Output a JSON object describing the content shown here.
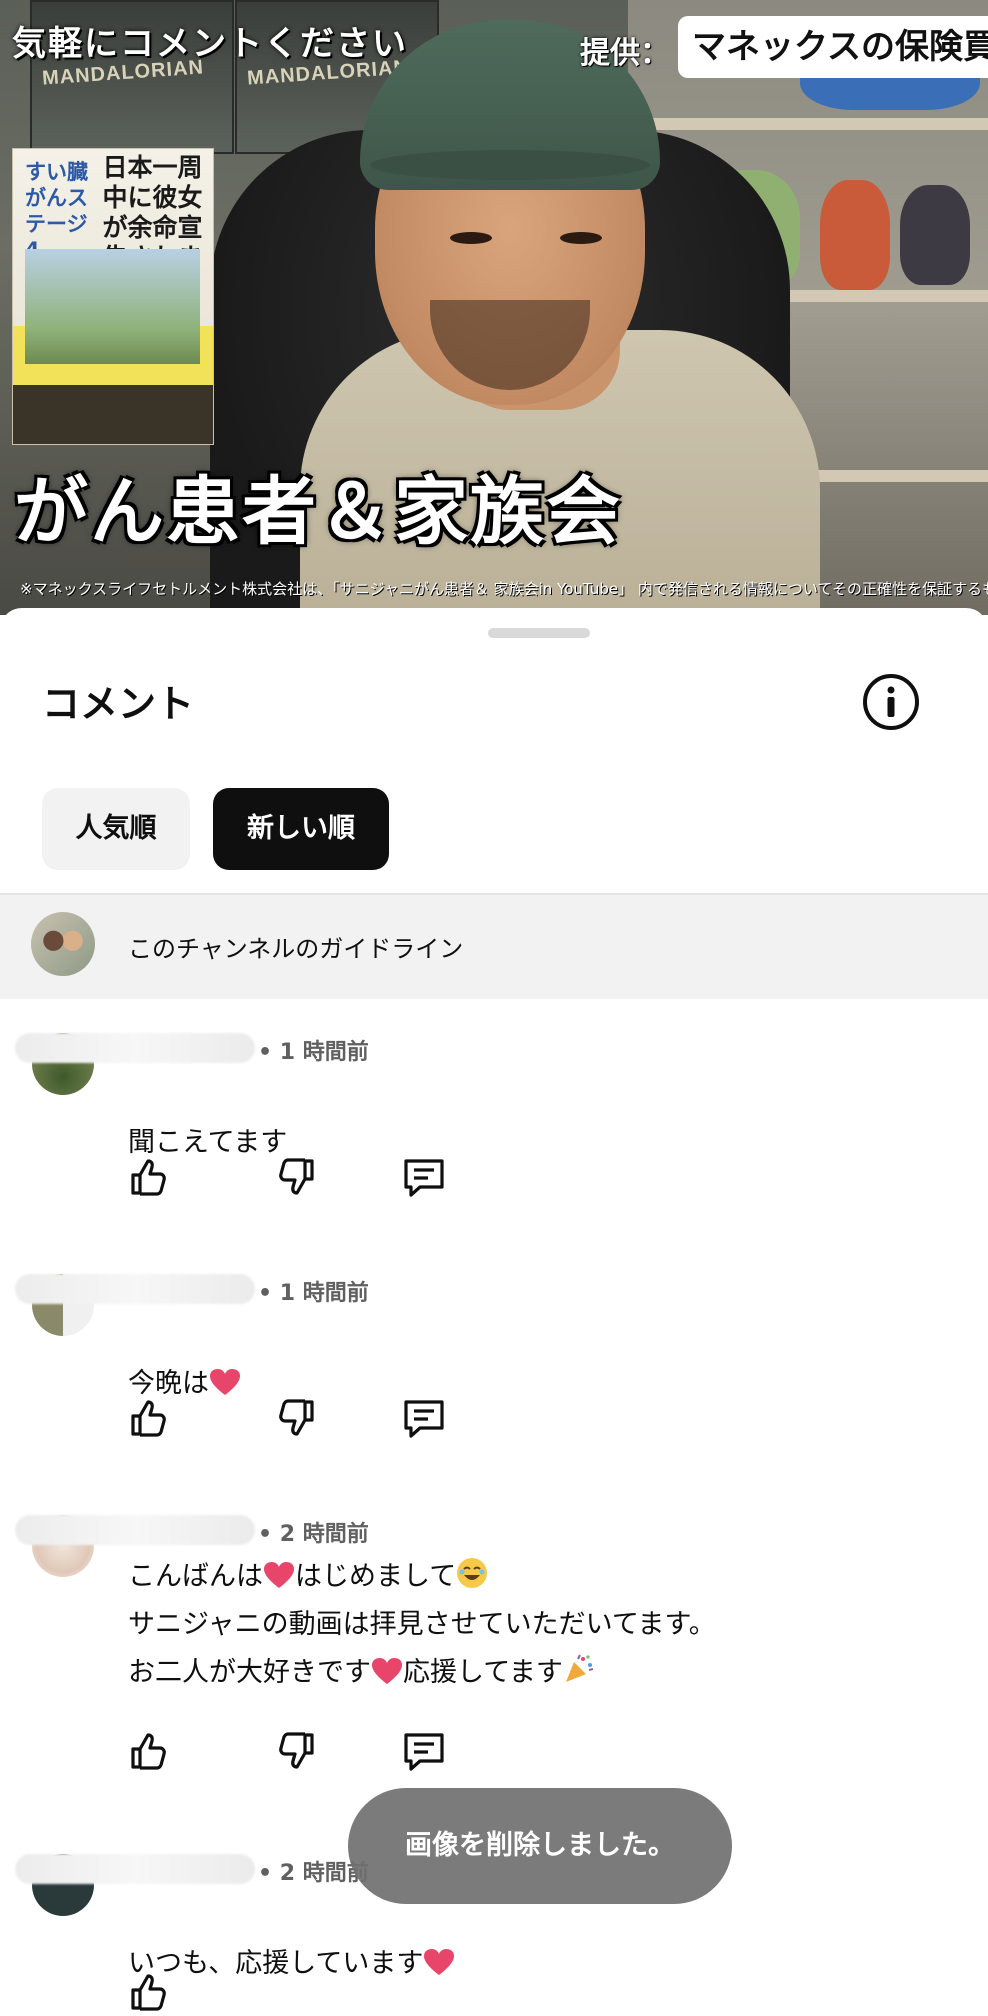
{
  "video": {
    "overlay_top_left": "気軽にコメントください",
    "sponsor_label": "提供：",
    "sponsor_name": "マネックスの保険買",
    "book_title_left": "すい臓がんステージ4",
    "book_title_right": "日本一周中に彼女が余命宣告されました。",
    "big_caption": "がん患者＆家族会",
    "disclaimer": "※マネックスライフセトルメント株式会社は、「サニジャニがん患者＆ 家族会in YouTube」 内で発信される情報についてその正確性を保証するものではありません",
    "poster_text": "MANDALORIAN"
  },
  "sheet": {
    "title": "コメント",
    "info_icon": "info-icon",
    "sort_chips": [
      {
        "label": "人気順",
        "selected": false
      },
      {
        "label": "新しい順",
        "selected": true
      }
    ],
    "guideline_label": "このチャンネルのガイドライン"
  },
  "comments": [
    {
      "time": "• 1 時間前",
      "text": "聞こえてます"
    },
    {
      "time": "• 1 時間前",
      "text": "今晩は",
      "emoji_after": "heart"
    },
    {
      "time": "• 2 時間前",
      "lines": [
        "こんばんは|heart|はじめまして|laugh",
        "サニジャニの動画は拝見させていただいてます。",
        "お二人が大好きです|heart|応援してます|party"
      ]
    },
    {
      "time": "• 2 時間前",
      "text": "いつも、応援しています",
      "emoji_after": "heart"
    }
  ],
  "toast": "画像を削除しました。",
  "colors": {
    "chip_selected_bg": "#0f0f0f",
    "chip_bg": "#f2f2f2",
    "heart": "#e8456a",
    "toast_bg": "#707070"
  }
}
